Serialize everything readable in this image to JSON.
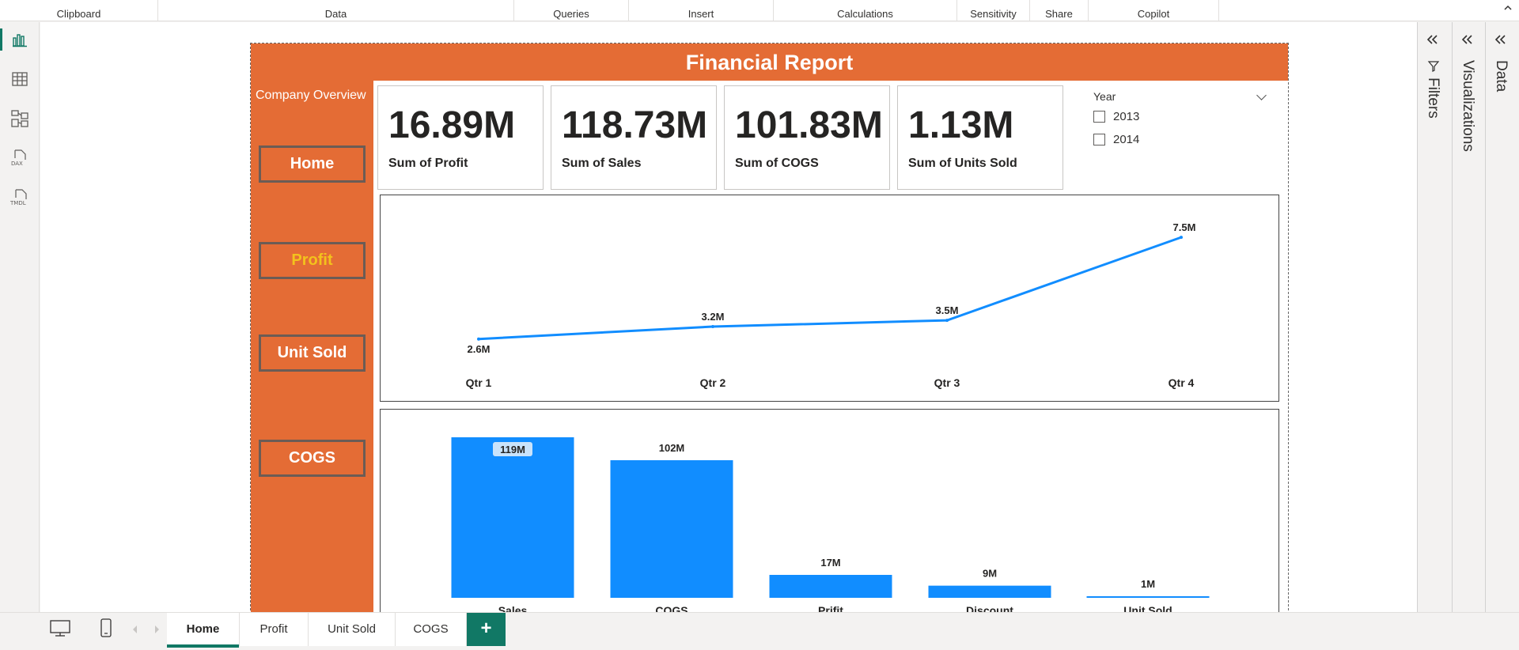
{
  "ribbon": {
    "groups": [
      "Clipboard",
      "Data",
      "Queries",
      "Insert",
      "Calculations",
      "Sensitivity",
      "Share",
      "Copilot"
    ]
  },
  "report": {
    "title": "Financial Report",
    "company_overview": "Company Overview",
    "nav_buttons": [
      "Home",
      "Profit",
      "Unit Sold",
      "COGS"
    ],
    "cards": [
      {
        "value": "16.89M",
        "label": "Sum of Profit"
      },
      {
        "value": "118.73M",
        "label": "Sum of Sales"
      },
      {
        "value": "101.83M",
        "label": "Sum of COGS"
      },
      {
        "value": "1.13M",
        "label": "Sum of Units Sold"
      }
    ],
    "slicer": {
      "title": "Year",
      "options": [
        "2013",
        "2014"
      ]
    }
  },
  "chart_data": [
    {
      "type": "line",
      "categories": [
        "Qtr 1",
        "Qtr 2",
        "Qtr 3",
        "Qtr 4"
      ],
      "values": [
        2.6,
        3.2,
        3.5,
        7.5
      ],
      "data_labels": [
        "2.6M",
        "3.2M",
        "3.5M",
        "7.5M"
      ],
      "ylim": [
        0,
        8
      ],
      "color": "#118dff"
    },
    {
      "type": "bar",
      "categories": [
        "Sales",
        "COGS",
        "Prifit",
        "Discount",
        "Unit Sold"
      ],
      "values": [
        119,
        102,
        17,
        9,
        1
      ],
      "data_labels": [
        "119M",
        "102M",
        "17M",
        "9M",
        "1M"
      ],
      "ylim": [
        0,
        119
      ],
      "color": "#118dff"
    }
  ],
  "panes": {
    "filters": "Filters",
    "visualizations": "Visualizations",
    "data": "Data"
  },
  "page_tabs": [
    "Home",
    "Profit",
    "Unit Sold",
    "COGS"
  ],
  "add_page": "+",
  "colors": {
    "accent": "#e46c35",
    "teal": "#117865",
    "series": "#118dff",
    "highlight": "#f3c21c"
  }
}
